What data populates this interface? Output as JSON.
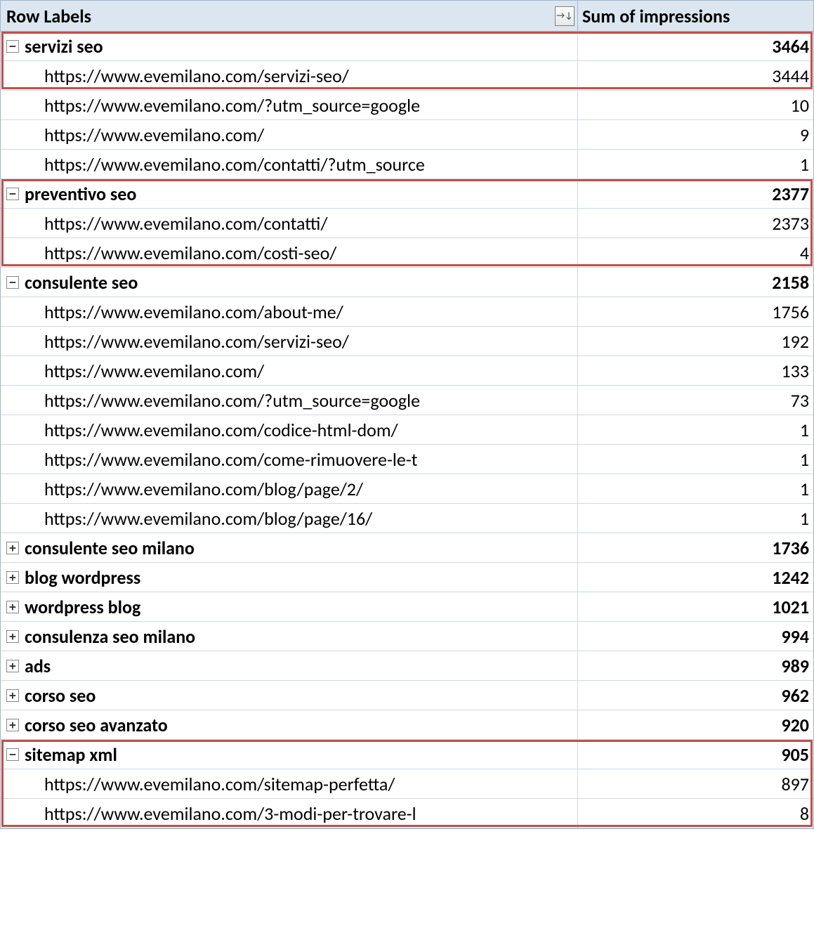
{
  "header": {
    "label": "Row Labels",
    "value": "Sum of impressions"
  },
  "groups": [
    {
      "expanded": true,
      "label": "servizi seo",
      "value": "3464",
      "highlight_children": 1,
      "children": [
        {
          "label": "https://www.evemilano.com/servizi-seo/",
          "value": "3444"
        },
        {
          "label": "https://www.evemilano.com/?utm_source=google",
          "value": "10",
          "truncated": true
        },
        {
          "label": "https://www.evemilano.com/",
          "value": "9"
        },
        {
          "label": "https://www.evemilano.com/contatti/?utm_source",
          "value": "1",
          "truncated": true
        }
      ]
    },
    {
      "expanded": true,
      "label": "preventivo seo",
      "value": "2377",
      "highlight_children": 2,
      "children": [
        {
          "label": "https://www.evemilano.com/contatti/",
          "value": "2373"
        },
        {
          "label": "https://www.evemilano.com/costi-seo/",
          "value": "4"
        }
      ]
    },
    {
      "expanded": true,
      "label": "consulente seo",
      "value": "2158",
      "children": [
        {
          "label": "https://www.evemilano.com/about-me/",
          "value": "1756"
        },
        {
          "label": "https://www.evemilano.com/servizi-seo/",
          "value": "192"
        },
        {
          "label": "https://www.evemilano.com/",
          "value": "133"
        },
        {
          "label": "https://www.evemilano.com/?utm_source=google",
          "value": "73",
          "truncated": true
        },
        {
          "label": "https://www.evemilano.com/codice-html-dom/",
          "value": "1"
        },
        {
          "label": "https://www.evemilano.com/come-rimuovere-le-t",
          "value": "1",
          "truncated": true
        },
        {
          "label": "https://www.evemilano.com/blog/page/2/",
          "value": "1"
        },
        {
          "label": "https://www.evemilano.com/blog/page/16/",
          "value": "1"
        }
      ]
    },
    {
      "expanded": false,
      "label": "consulente seo milano",
      "value": "1736"
    },
    {
      "expanded": false,
      "label": "blog wordpress",
      "value": "1242"
    },
    {
      "expanded": false,
      "label": "wordpress blog",
      "value": "1021"
    },
    {
      "expanded": false,
      "label": "consulenza seo milano",
      "value": "994"
    },
    {
      "expanded": false,
      "label": "ads",
      "value": "989"
    },
    {
      "expanded": false,
      "label": "corso seo",
      "value": "962"
    },
    {
      "expanded": false,
      "label": "corso seo avanzato",
      "value": "920"
    },
    {
      "expanded": true,
      "label": "sitemap xml",
      "value": "905",
      "highlight_children": 2,
      "children": [
        {
          "label": "https://www.evemilano.com/sitemap-perfetta/",
          "value": "897"
        },
        {
          "label": "https://www.evemilano.com/3-modi-per-trovare-l",
          "value": "8",
          "truncated": true
        }
      ]
    }
  ]
}
